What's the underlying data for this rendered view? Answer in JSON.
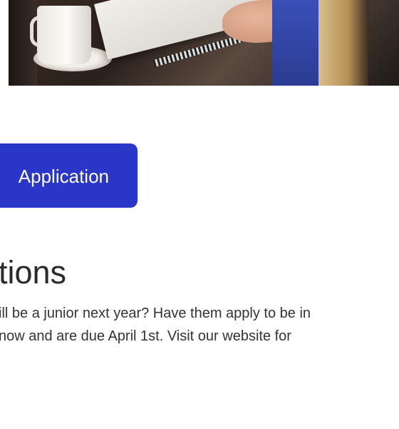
{
  "hero": {
    "image_desc": "photo"
  },
  "application_button": {
    "label": "Application"
  },
  "section": {
    "title": "tions",
    "body_lines": [
      "ill be a junior next year? Have them apply to be in",
      " now and are due April 1st. Visit our website for"
    ]
  }
}
